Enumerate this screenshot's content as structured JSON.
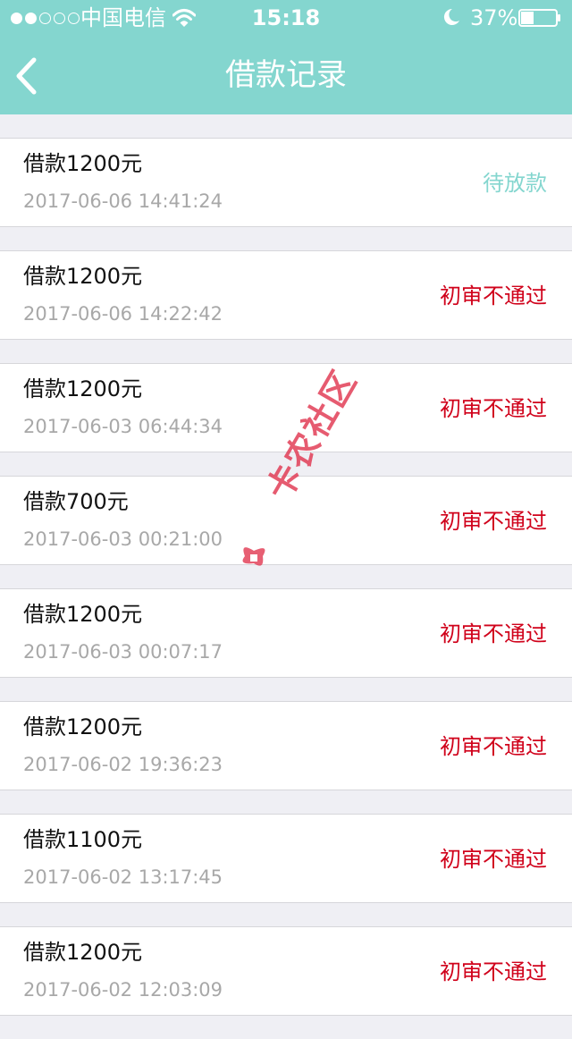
{
  "status_bar": {
    "carrier": "中国电信",
    "time": "15:18",
    "battery": "37%",
    "battery_level": 0.37,
    "signal_filled": 2,
    "signal_total": 5
  },
  "nav": {
    "title": "借款记录",
    "back_icon": "chevron-left-icon"
  },
  "colors": {
    "header_bg": "#84d6cf",
    "pending": "#84d6cf",
    "rejected": "#d0021b"
  },
  "records": [
    {
      "title": "借款1200元",
      "time": "2017-06-06 14:41:24",
      "status": "待放款",
      "status_type": "pending"
    },
    {
      "title": "借款1200元",
      "time": "2017-06-06 14:22:42",
      "status": "初审不通过",
      "status_type": "rejected"
    },
    {
      "title": "借款1200元",
      "time": "2017-06-03 06:44:34",
      "status": "初审不通过",
      "status_type": "rejected"
    },
    {
      "title": "借款700元",
      "time": "2017-06-03 00:21:00",
      "status": "初审不通过",
      "status_type": "rejected"
    },
    {
      "title": "借款1200元",
      "time": "2017-06-03 00:07:17",
      "status": "初审不通过",
      "status_type": "rejected"
    },
    {
      "title": "借款1200元",
      "time": "2017-06-02 19:36:23",
      "status": "初审不通过",
      "status_type": "rejected"
    },
    {
      "title": "借款1100元",
      "time": "2017-06-02 13:17:45",
      "status": "初审不通过",
      "status_type": "rejected"
    },
    {
      "title": "借款1200元",
      "time": "2017-06-02 12:03:09",
      "status": "初审不通过",
      "status_type": "rejected"
    }
  ],
  "watermark": {
    "text": "卡农社区"
  }
}
